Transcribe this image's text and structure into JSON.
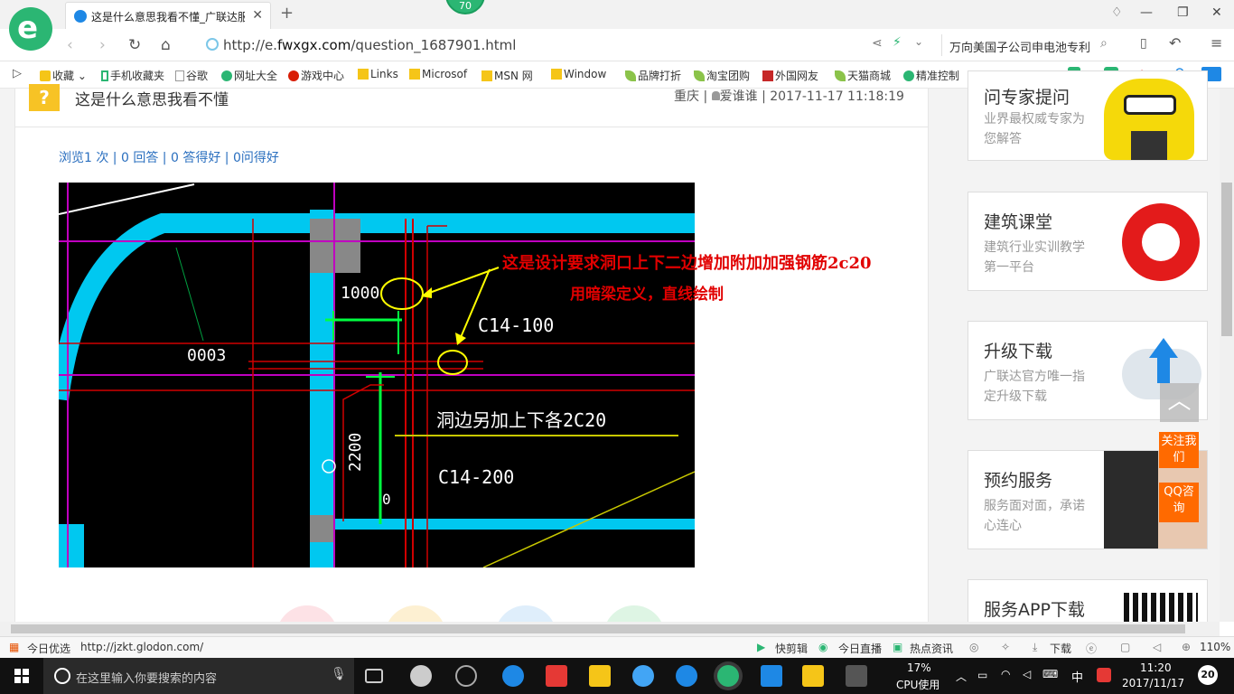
{
  "browser": {
    "tab_title": "这是什么意思我看不懂_广联达服",
    "badge_count": "70",
    "url_prefix": "http://e.",
    "url_domain": "fwxgx.com",
    "url_path": "/question_1687901.html",
    "search_text": "万向美国子公司申电池专利"
  },
  "bookmarks": [
    {
      "label": "收藏",
      "icon": "star-icon",
      "color": "#f5c518"
    },
    {
      "label": "手机收藏夹",
      "icon": "phone-icon",
      "color": "#2bb673"
    },
    {
      "label": "谷歌",
      "icon": "page-icon",
      "color": "#999999"
    },
    {
      "label": "网址大全",
      "icon": "globe-icon",
      "color": "#2bb673"
    },
    {
      "label": "游戏中心",
      "icon": "game-icon",
      "color": "#d81e06"
    },
    {
      "label": "Links",
      "icon": "folder-icon",
      "color": "#f5c518"
    },
    {
      "label": "Microsof",
      "icon": "folder-icon",
      "color": "#f5c518"
    },
    {
      "label": "MSN 网",
      "icon": "folder-icon",
      "color": "#f5c518"
    },
    {
      "label": "Window",
      "icon": "folder-icon",
      "color": "#f5c518"
    },
    {
      "label": "品牌打折",
      "icon": "leaf-icon",
      "color": "#8bc34a"
    },
    {
      "label": "淘宝团购",
      "icon": "leaf-icon",
      "color": "#8bc34a"
    },
    {
      "label": "外国网友",
      "icon": "flag-icon",
      "color": "#c62828"
    },
    {
      "label": "天猫商城",
      "icon": "leaf-icon",
      "color": "#8bc34a"
    },
    {
      "label": "精准控制",
      "icon": "chat-icon",
      "color": "#2bb673"
    }
  ],
  "question": {
    "title": "这是什么意思我看不懂",
    "location": "重庆",
    "author": "爱谁谁",
    "time": "2017-11-17 11:18:19",
    "stats": [
      "浏览1 次",
      "0 回答",
      "0 答得好",
      "0问得好"
    ]
  },
  "cad_drawing": {
    "labels": {
      "dim_1000": "1000",
      "rebar_top": "C14-100",
      "tag": "0003",
      "note": "洞边另加上下各2C20",
      "rebar_bottom": "C14-200",
      "dim_2200": "2200",
      "zero": "0"
    },
    "annotation_line1": "这是设计要求洞口上下二边增加附加加强钢筋2c20",
    "annotation_line2": "用暗梁定义，直线绘制"
  },
  "sidebar": {
    "expert": {
      "title": "问专家提问",
      "desc": "业界最权威专家为您解答"
    },
    "class": {
      "title": "建筑课堂",
      "desc": "建筑行业实训教学第一平台"
    },
    "upgrade": {
      "title": "升级下载",
      "desc": "广联达官方唯一指定升级下载"
    },
    "service": {
      "title": "预约服务",
      "desc": "服务面对面，承诺心连心"
    },
    "app": {
      "title": "服务APP下载"
    },
    "follow_label": "关注我们",
    "qq_label": "QQ咨询"
  },
  "statusbar": {
    "left_label": "今日优选",
    "link_url": "http://jzkt.glodon.com/",
    "items": [
      "快剪辑",
      "今日直播",
      "热点资讯",
      "下载"
    ],
    "zoom": "110%"
  },
  "taskbar": {
    "search_placeholder": "在这里输入你要搜索的内容",
    "cpu_value": "17%",
    "cpu_label": "CPU使用",
    "ime": "中",
    "time": "11:20",
    "date": "2017/11/17",
    "notif_count": "20"
  }
}
